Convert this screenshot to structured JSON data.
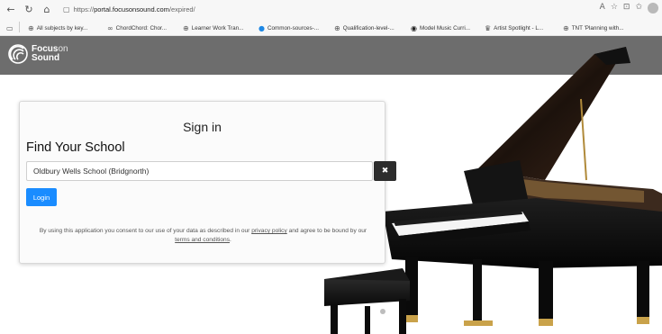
{
  "browser": {
    "url_prefix": "https://",
    "url_host": "portal.focusonsound.com",
    "url_path": "/expired/",
    "nav_icons": [
      "back-icon",
      "reload-icon",
      "home-icon"
    ],
    "bookmarks": [
      {
        "label": "All subjects by key...",
        "icon": "globe-icon"
      },
      {
        "label": "ChordChord: Chor...",
        "icon": "chord-icon"
      },
      {
        "label": "Learner Work Tran...",
        "icon": "globe-icon"
      },
      {
        "label": "Common-sources-...",
        "icon": "blue-circle-icon"
      },
      {
        "label": "Qualification-level-...",
        "icon": "globe-icon"
      },
      {
        "label": "Model Music Curri...",
        "icon": "dark-circle-icon"
      },
      {
        "label": "Artist Spotlight - L...",
        "icon": "spotlight-icon"
      },
      {
        "label": "TNT 'Planning with...",
        "icon": "globe-icon"
      }
    ]
  },
  "brand": {
    "name_focus": "Focus",
    "name_on": "on",
    "name_sound": "Sound"
  },
  "signin": {
    "title": "Sign in",
    "find_label": "Find Your School",
    "school_value": "Oldbury Wells School (Bridgnorth)",
    "clear_glyph": "✖",
    "login_label": "Login",
    "consent_pre": "By using this application you consent to our use of your data as described in our ",
    "privacy_link": "privacy policy",
    "consent_mid": " and agree to be bound by our ",
    "terms_link": "terms and conditions",
    "consent_end": "."
  },
  "colors": {
    "brandbar": "#6d6d6d",
    "login_button": "#1a8cff",
    "clear_button": "#2d2d2d"
  }
}
